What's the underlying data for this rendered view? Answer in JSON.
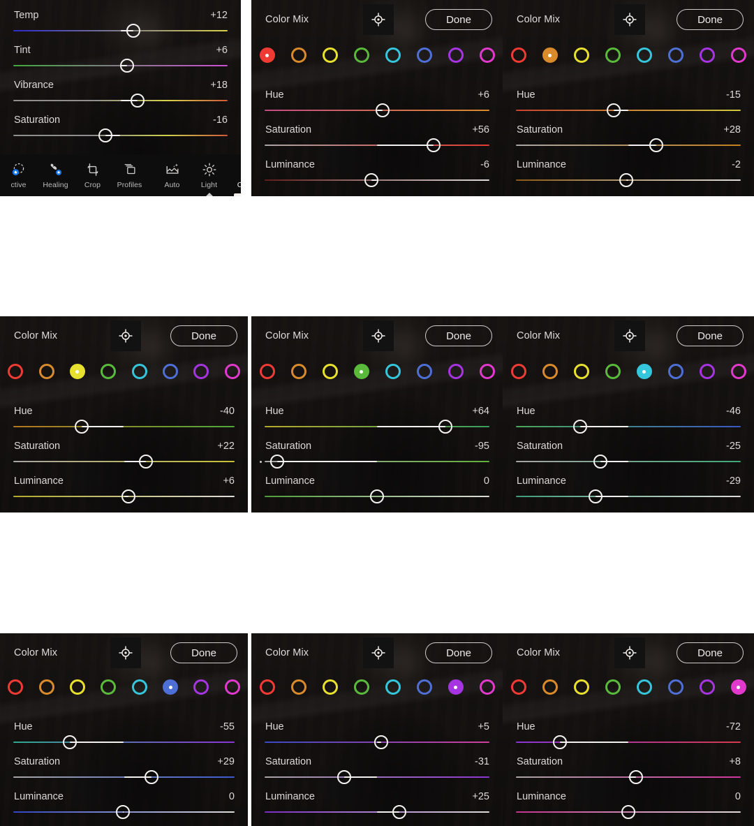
{
  "app": {
    "name": "Lightroom Mobile Color Mix",
    "colors": {
      "panel_bg": "#1c1a19",
      "toolbar_bg": "#0d0d0e",
      "text": "#dcdad8",
      "knob": "#f4f2f0",
      "accent_blue": "#1473e6"
    }
  },
  "panels": [
    {
      "id": "panel-light",
      "kind": "light",
      "sliders": [
        {
          "label": "Temp",
          "value": "+12",
          "pos": 0.56,
          "from": "#2b2bcf",
          "to": "#d8d04a"
        },
        {
          "label": "Tint",
          "value": "+6",
          "pos": 0.53,
          "from": "#3fa83f",
          "to": "#cc4fd4"
        },
        {
          "label": "Vibrance",
          "value": "+18",
          "pos": 0.58,
          "from": "#8f8f8f",
          "to": "#d6d24a",
          "to2": "#d05a3a"
        },
        {
          "label": "Saturation",
          "value": "-16",
          "pos": 0.43,
          "from": "#8f8f8f",
          "to": "#cdd04a",
          "to2": "#d05a3a"
        }
      ],
      "toolbar": {
        "left_items": [
          {
            "label": "ctive",
            "icon": "selective-icon",
            "active": false
          },
          {
            "label": "Healing",
            "icon": "healing-brush-icon",
            "active": false
          },
          {
            "label": "Crop",
            "icon": "crop-icon",
            "active": false
          },
          {
            "label": "Profiles",
            "icon": "profiles-icon",
            "active": false
          }
        ],
        "right_items": [
          {
            "label": "Auto",
            "icon": "auto-enhance-icon",
            "active": false
          },
          {
            "label": "Light",
            "icon": "sun-icon",
            "active": false
          },
          {
            "label": "Color",
            "icon": "thermometer-icon",
            "active": true
          }
        ]
      }
    },
    {
      "id": "panel-red",
      "kind": "mix",
      "title": "Color Mix",
      "done_label": "Done",
      "target_icon": "target-picker-icon",
      "selected_index": 0,
      "swatches": [
        {
          "name": "red",
          "color": "#ef3b33"
        },
        {
          "name": "orange",
          "color": "#d98a2b"
        },
        {
          "name": "yellow",
          "color": "#e8e02e"
        },
        {
          "name": "green",
          "color": "#5aba3c"
        },
        {
          "name": "aqua",
          "color": "#35c6dc"
        },
        {
          "name": "blue",
          "color": "#4d6fd6"
        },
        {
          "name": "purple",
          "color": "#a634e0"
        },
        {
          "name": "magenta",
          "color": "#e039cc"
        }
      ],
      "sliders": [
        {
          "label": "Hue",
          "value": "+6",
          "pos": 0.525,
          "from": "#c44b86",
          "to": "#d98a2b"
        },
        {
          "label": "Saturation",
          "value": "+56",
          "pos": 0.75,
          "from": "#a8a6a4",
          "to": "#e03a33"
        },
        {
          "label": "Luminance",
          "value": "-6",
          "pos": 0.475,
          "from": "#5e1c1a",
          "to": "#dedcda"
        }
      ]
    },
    {
      "id": "panel-orange",
      "kind": "mix",
      "title": "Color Mix",
      "done_label": "Done",
      "target_icon": "target-picker-icon",
      "selected_index": 1,
      "swatches": [
        {
          "name": "red",
          "color": "#ef3b33"
        },
        {
          "name": "orange",
          "color": "#d98a2b"
        },
        {
          "name": "yellow",
          "color": "#e8e02e"
        },
        {
          "name": "green",
          "color": "#5aba3c"
        },
        {
          "name": "aqua",
          "color": "#35c6dc"
        },
        {
          "name": "blue",
          "color": "#4d6fd6"
        },
        {
          "name": "purple",
          "color": "#a634e0"
        },
        {
          "name": "magenta",
          "color": "#e039cc"
        }
      ],
      "sliders": [
        {
          "label": "Hue",
          "value": "-15",
          "pos": 0.435,
          "from": "#c9422f",
          "to": "#cfc83e"
        },
        {
          "label": "Saturation",
          "value": "+28",
          "pos": 0.625,
          "from": "#a8a6a4",
          "to": "#c2801f"
        },
        {
          "label": "Luminance",
          "value": "-2",
          "pos": 0.49,
          "from": "#8a5a14",
          "to": "#dedcda"
        }
      ]
    },
    {
      "id": "panel-yellow",
      "kind": "mix",
      "title": "Color Mix",
      "done_label": "Done",
      "target_icon": "target-picker-icon",
      "selected_index": 2,
      "swatches": [
        {
          "name": "red",
          "color": "#ef3b33"
        },
        {
          "name": "orange",
          "color": "#d98a2b"
        },
        {
          "name": "yellow",
          "color": "#e8e02e"
        },
        {
          "name": "green",
          "color": "#5aba3c"
        },
        {
          "name": "aqua",
          "color": "#35c6dc"
        },
        {
          "name": "blue",
          "color": "#4d6fd6"
        },
        {
          "name": "purple",
          "color": "#a634e0"
        },
        {
          "name": "magenta",
          "color": "#e039cc"
        }
      ],
      "sliders": [
        {
          "label": "Hue",
          "value": "-40",
          "pos": 0.31,
          "from": "#b4761e",
          "to": "#4fa83a"
        },
        {
          "label": "Saturation",
          "value": "+22",
          "pos": 0.6,
          "from": "#a8a6a4",
          "to": "#c8c134"
        },
        {
          "label": "Luminance",
          "value": "+6",
          "pos": 0.52,
          "from": "#b0a92c",
          "to": "#dedcda"
        }
      ]
    },
    {
      "id": "panel-green",
      "kind": "mix",
      "title": "Color Mix",
      "done_label": "Done",
      "target_icon": "target-picker-icon",
      "selected_index": 3,
      "swatches": [
        {
          "name": "red",
          "color": "#ef3b33"
        },
        {
          "name": "orange",
          "color": "#d98a2b"
        },
        {
          "name": "yellow",
          "color": "#e8e02e"
        },
        {
          "name": "green",
          "color": "#5aba3c"
        },
        {
          "name": "aqua",
          "color": "#35c6dc"
        },
        {
          "name": "blue",
          "color": "#4d6fd6"
        },
        {
          "name": "purple",
          "color": "#a634e0"
        },
        {
          "name": "magenta",
          "color": "#e039cc"
        }
      ],
      "sliders": [
        {
          "label": "Hue",
          "value": "+64",
          "pos": 0.805,
          "from": "#b5a82b",
          "to": "#39a05e"
        },
        {
          "label": "Saturation",
          "value": "-95",
          "pos": 0.055,
          "from": "#a8a6a4",
          "to": "#62b03a",
          "minidot": true
        },
        {
          "label": "Luminance",
          "value": "0",
          "pos": 0.5,
          "from": "#4f9c39",
          "to": "#dedcda"
        }
      ]
    },
    {
      "id": "panel-aqua",
      "kind": "mix",
      "title": "Color Mix",
      "done_label": "Done",
      "target_icon": "target-picker-icon",
      "selected_index": 4,
      "swatches": [
        {
          "name": "red",
          "color": "#ef3b33"
        },
        {
          "name": "orange",
          "color": "#d98a2b"
        },
        {
          "name": "yellow",
          "color": "#e8e02e"
        },
        {
          "name": "green",
          "color": "#5aba3c"
        },
        {
          "name": "aqua",
          "color": "#35c6dc"
        },
        {
          "name": "blue",
          "color": "#4d6fd6"
        },
        {
          "name": "purple",
          "color": "#a634e0"
        },
        {
          "name": "magenta",
          "color": "#e039cc"
        }
      ],
      "sliders": [
        {
          "label": "Hue",
          "value": "-46",
          "pos": 0.285,
          "from": "#4aa859",
          "to": "#3a59c4"
        },
        {
          "label": "Saturation",
          "value": "-25",
          "pos": 0.375,
          "from": "#a8a6a4",
          "to": "#3fa878"
        },
        {
          "label": "Luminance",
          "value": "-29",
          "pos": 0.355,
          "from": "#3f9c7a",
          "to": "#dedcda"
        }
      ]
    },
    {
      "id": "panel-blue",
      "kind": "mix",
      "title": "Color Mix",
      "done_label": "Done",
      "target_icon": "target-picker-icon",
      "selected_index": 5,
      "swatches": [
        {
          "name": "red",
          "color": "#ef3b33"
        },
        {
          "name": "orange",
          "color": "#d98a2b"
        },
        {
          "name": "yellow",
          "color": "#e8e02e"
        },
        {
          "name": "green",
          "color": "#5aba3c"
        },
        {
          "name": "aqua",
          "color": "#35c6dc"
        },
        {
          "name": "blue",
          "color": "#4d6fd6"
        },
        {
          "name": "purple",
          "color": "#a634e0"
        },
        {
          "name": "magenta",
          "color": "#e039cc"
        }
      ],
      "sliders": [
        {
          "label": "Hue",
          "value": "-55",
          "pos": 0.255,
          "from": "#2fa88f",
          "to": "#8b35d6"
        },
        {
          "label": "Saturation",
          "value": "+29",
          "pos": 0.625,
          "from": "#a8a6a4",
          "to": "#3a5ad0"
        },
        {
          "label": "Luminance",
          "value": "0",
          "pos": 0.495,
          "from": "#2f46c0",
          "to": "#dedcda"
        }
      ]
    },
    {
      "id": "panel-purple",
      "kind": "mix",
      "title": "Color Mix",
      "done_label": "Done",
      "target_icon": "target-picker-icon",
      "selected_index": 6,
      "swatches": [
        {
          "name": "red",
          "color": "#ef3b33"
        },
        {
          "name": "orange",
          "color": "#d98a2b"
        },
        {
          "name": "yellow",
          "color": "#e8e02e"
        },
        {
          "name": "green",
          "color": "#5aba3c"
        },
        {
          "name": "aqua",
          "color": "#35c6dc"
        },
        {
          "name": "blue",
          "color": "#4d6fd6"
        },
        {
          "name": "purple",
          "color": "#a634e0"
        },
        {
          "name": "magenta",
          "color": "#e039cc"
        }
      ],
      "sliders": [
        {
          "label": "Hue",
          "value": "+5",
          "pos": 0.52,
          "from": "#3a49c4",
          "to": "#d13f9e"
        },
        {
          "label": "Saturation",
          "value": "-31",
          "pos": 0.355,
          "from": "#a8a6a4",
          "to": "#8c35d2"
        },
        {
          "label": "Luminance",
          "value": "+25",
          "pos": 0.6,
          "from": "#7a2cc2",
          "to": "#dedcda"
        }
      ]
    },
    {
      "id": "panel-magenta",
      "kind": "mix",
      "title": "Color Mix",
      "done_label": "Done",
      "target_icon": "target-picker-icon",
      "selected_index": 7,
      "swatches": [
        {
          "name": "red",
          "color": "#ef3b33"
        },
        {
          "name": "orange",
          "color": "#d98a2b"
        },
        {
          "name": "yellow",
          "color": "#e8e02e"
        },
        {
          "name": "green",
          "color": "#5aba3c"
        },
        {
          "name": "aqua",
          "color": "#35c6dc"
        },
        {
          "name": "blue",
          "color": "#4d6fd6"
        },
        {
          "name": "purple",
          "color": "#a634e0"
        },
        {
          "name": "magenta",
          "color": "#e039cc"
        }
      ],
      "sliders": [
        {
          "label": "Hue",
          "value": "-72",
          "pos": 0.195,
          "from": "#8b35d6",
          "to": "#d63a4f"
        },
        {
          "label": "Saturation",
          "value": "+8",
          "pos": 0.535,
          "from": "#a8a6a4",
          "to": "#d0359e"
        },
        {
          "label": "Luminance",
          "value": "0",
          "pos": 0.5,
          "from": "#c0338e",
          "to": "#dedcda"
        }
      ]
    }
  ]
}
